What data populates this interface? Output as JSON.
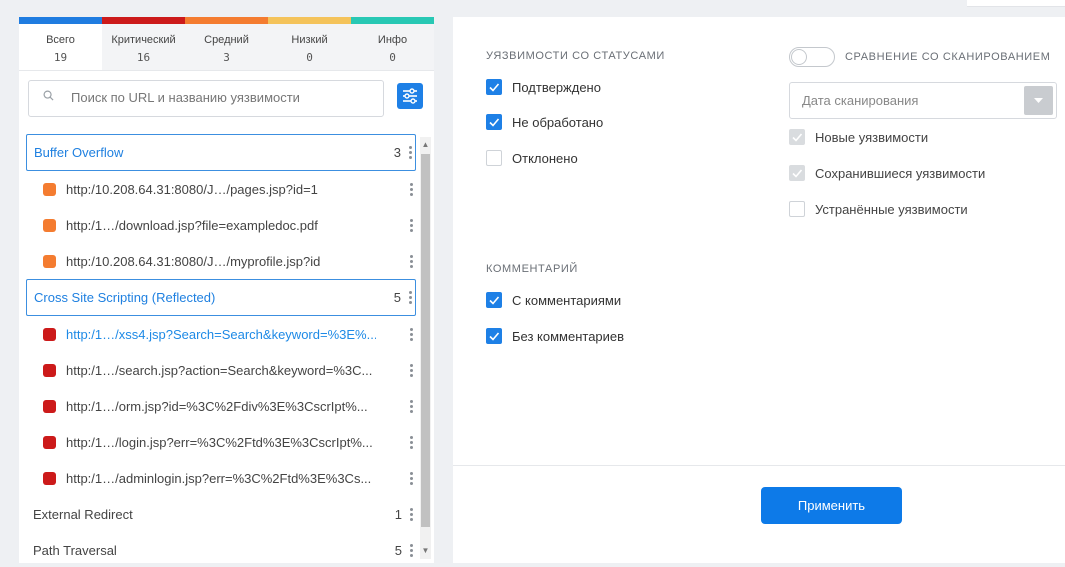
{
  "severity": {
    "colors": [
      "#1f7ce0",
      "#cc1a1a",
      "#f47c30",
      "#f4c35a",
      "#28c8b4"
    ],
    "tabs": [
      {
        "label": "Всего",
        "count": "19"
      },
      {
        "label": "Критический",
        "count": "16"
      },
      {
        "label": "Средний",
        "count": "3"
      },
      {
        "label": "Низкий",
        "count": "0"
      },
      {
        "label": "Инфо",
        "count": "0"
      }
    ]
  },
  "search": {
    "placeholder": "Поиск по URL и названию уязвимости",
    "value": ""
  },
  "vulns": {
    "g1": {
      "name": "Buffer Overflow",
      "count": "3"
    },
    "g1_items": [
      "http:/10.208.64.31:8080/J…/pages.jsp?id=1",
      "http:/1…/download.jsp?file=exampledoc.pdf",
      "http:/10.208.64.31:8080/J…/myprofile.jsp?id"
    ],
    "g2": {
      "name": "Cross Site Scripting (Reflected)",
      "count": "5"
    },
    "g2_items": [
      "http:/1…/xss4.jsp?Search=Search&keyword=%3E%...",
      "http:/1…/search.jsp?action=Search&keyword=%3C...",
      "http:/1…/orm.jsp?id=%3C%2Fdiv%3E%3CscrIpt%...",
      "http:/1…/login.jsp?err=%3C%2Ftd%3E%3CscrIpt%...",
      "http:/1…/adminlogin.jsp?err=%3C%2Ftd%3E%3Cs..."
    ],
    "g3": {
      "name": "External Redirect",
      "count": "1"
    },
    "g4": {
      "name": "Path Traversal",
      "count": "5"
    },
    "colors": {
      "medium": "#f47c30",
      "critical": "#cc1a1a",
      "link": "#1e8ae6",
      "accent": "#1e80e6"
    }
  },
  "filters": {
    "status_title": "УЯЗВИМОСТИ СО СТАТУСАМИ",
    "status": [
      {
        "label": "Подтверждено",
        "checked": true
      },
      {
        "label": "Не обработано",
        "checked": true
      },
      {
        "label": "Отклонено",
        "checked": false
      }
    ],
    "comment_title": "КОММЕНТАРИЙ",
    "comment": [
      {
        "label": "С комментариями",
        "checked": true
      },
      {
        "label": "Без комментариев",
        "checked": true
      }
    ],
    "compare_title": "СРАВНЕНИЕ СО СКАНИРОВАНИЕМ",
    "compare_enabled": false,
    "scan_date_placeholder": "Дата сканирования",
    "compare": [
      {
        "label": "Новые уязвимости",
        "checked": true,
        "disabled": true
      },
      {
        "label": "Сохранившиеся уязвимости",
        "checked": true,
        "disabled": true
      },
      {
        "label": "Устранённые уязвимости",
        "checked": false,
        "disabled": true
      }
    ],
    "apply_label": "Применить"
  }
}
